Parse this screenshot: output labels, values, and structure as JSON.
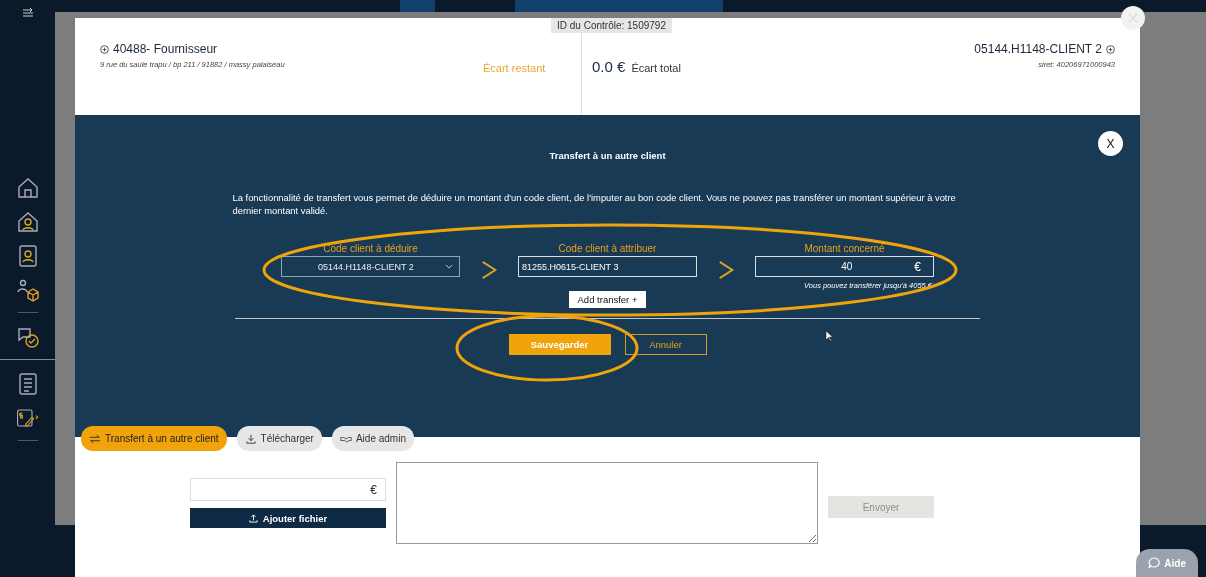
{
  "control_id": "ID du Contrôle: 1509792",
  "supplier": {
    "name": "40488- Fournisseur",
    "address": "9 rue du saule trapu / bp 211 / 91882 / massy palaiseau"
  },
  "remaining_label": "Écart restant",
  "total": {
    "amount": "0.0 €",
    "label": "Écart total"
  },
  "client": {
    "name": "05144.H1148-CLIENT 2",
    "siret": "siret: 40206971000943"
  },
  "transfer_dialog": {
    "title": "Transfert à un autre client",
    "close": "X",
    "description": "La fonctionnalité de transfert vous permet de déduire un montant d'un code client, de l'imputer au bon code client. Vous ne pouvez pas transférer un montant supérieur à votre dernier montant validé.",
    "fields": [
      {
        "kind": "select",
        "label": "Code client à déduire",
        "value": "05144.H1148-CLIENT 2"
      },
      {
        "kind": "text",
        "label": "Code client à attribuer",
        "value": "81255.H0615-CLIENT 3"
      },
      {
        "kind": "amount",
        "label": "Montant concerné",
        "value": "40",
        "suffix": "€",
        "hint": "Vous pouvez transférer jusqu'à 4055 €"
      }
    ],
    "add_button": "Add transfer +",
    "buttons": [
      {
        "kind": "primary",
        "label": "Sauvegarder"
      },
      {
        "kind": "secondary",
        "label": "Annuler"
      }
    ]
  },
  "tabs": [
    {
      "kind": "transfer",
      "label": "Transfert à un autre client",
      "selected": true
    },
    {
      "kind": "download",
      "label": "Télécharger",
      "selected": false
    },
    {
      "kind": "admin",
      "label": "Aide admin",
      "selected": false
    }
  ],
  "comment_form": {
    "amount_suffix": "€",
    "upload_button": "Ajouter fichier",
    "send_button": {
      "label": "Envoyer",
      "disabled": true
    }
  },
  "help_button": "Aide"
}
